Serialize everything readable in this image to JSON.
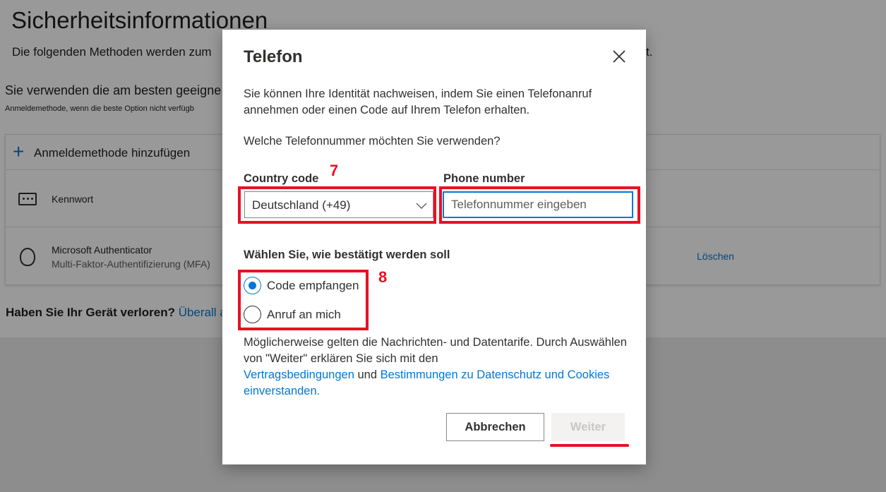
{
  "background": {
    "title": "Sicherheitsinformationen",
    "subtitle": "Die folgenden Methoden werden zum",
    "subtitle_tail": "t.",
    "info": "Sie verwenden die am besten geeigne",
    "info_small": "Anmeldemethode, wenn die beste Option nicht verfügb",
    "add_method": "Anmeldemethode hinzufügen",
    "methods": [
      {
        "label": "Kennwort",
        "sub": ""
      },
      {
        "label": "Microsoft Authenticator",
        "sub": "Multi-Faktor-Authentifizierung (MFA)"
      }
    ],
    "delete_label": "Löschen",
    "lost_device": "Haben Sie Ihr Gerät verloren?",
    "lost_link": "Überall a"
  },
  "dialog": {
    "title": "Telefon",
    "description": "Sie können Ihre Identität nachweisen, indem Sie einen Telefonanruf annehmen oder einen Code auf Ihrem Telefon erhalten.",
    "question": "Welche Telefonnummer möchten Sie verwenden?",
    "country_label": "Country code",
    "country_value": "Deutschland (+49)",
    "phone_label": "Phone number",
    "phone_placeholder": "Telefonnummer eingeben",
    "phone_value": "",
    "verify_label": "Wählen Sie, wie bestätigt werden soll",
    "options": [
      {
        "label": "Code empfangen",
        "checked": true
      },
      {
        "label": "Anruf an mich",
        "checked": false
      }
    ],
    "terms_text": "Möglicherweise gelten die Nachrichten- und Datentarife. Durch Auswählen von \"Weiter\" erklären Sie sich mit den",
    "terms_link1": "Vertragsbedingungen",
    "terms_and": "und",
    "terms_link2": "Bestimmungen zu Datenschutz und Cookies einverstanden.",
    "cancel_label": "Abbrechen",
    "next_label": "Weiter"
  },
  "annotations": {
    "num1": "7",
    "num2": "8",
    "color": "#e81123"
  },
  "colors": {
    "accent": "#0078d4",
    "overlay": "rgba(0,0,0,0.4)"
  }
}
